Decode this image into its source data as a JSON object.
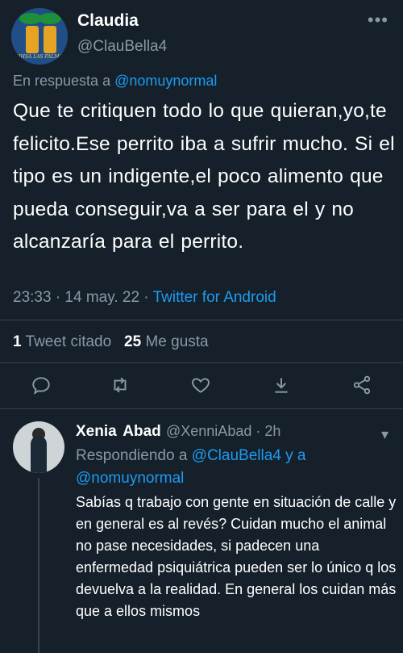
{
  "tweet": {
    "author_name": "Claudia",
    "author_handle": "@ClauBella4",
    "avatar_caption": "AHHSA LAS PALMAS",
    "reply_prefix": "En respuesta a",
    "reply_to": "@nomuynormal",
    "text": "Que te critiquen todo lo que quieran,yo,te felicito.Ese perrito iba a sufrir mucho. Si el tipo es un indigente,el poco alimento que pueda conseguir,va a ser para el y no alcanzaría para el perrito.",
    "time": "23:33 · 14 may. 22 ·",
    "source": "Twitter for Android",
    "quote_count": "1",
    "quote_label": "Tweet citado",
    "like_count": "25",
    "like_label": "Me gusta"
  },
  "reply": {
    "author_name": "Xenia Abad",
    "author_handle": "@XenniAbad · 2h",
    "replying_prefix": "Respondiendo a",
    "replying_to": "@ClauBella4 y a @nomuynormal",
    "text": "Sabías q trabajo con gente en situación de calle y en general es al revés? Cuidan mucho  el animal no pase necesidades, si padecen una enfermedad psiquiátrica pueden ser lo único q los devuelva a la realidad. En general los cuidan más que a ellos mismos"
  },
  "icons": [
    "more-icon",
    "reply-icon",
    "retweet-icon",
    "like-icon",
    "bookmark-icon",
    "share-icon"
  ],
  "colors": {
    "background": "#15202b",
    "link": "#1d9bf0",
    "secondary_text": "#8899a6",
    "divider": "#38444d"
  }
}
